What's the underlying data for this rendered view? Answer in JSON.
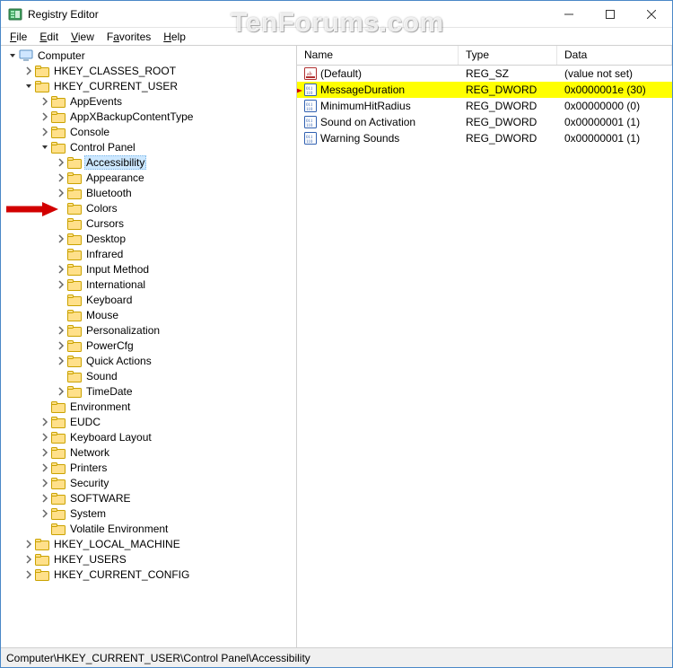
{
  "window": {
    "title": "Registry Editor"
  },
  "menu": {
    "file": "File",
    "edit": "Edit",
    "view": "View",
    "favorites": "Favorites",
    "help": "Help"
  },
  "watermark": "TenForums.com",
  "columns": {
    "name": "Name",
    "type": "Type",
    "data": "Data"
  },
  "values": [
    {
      "name": "(Default)",
      "type": "REG_SZ",
      "data": "(value not set)",
      "iconKind": "sz",
      "highlight": false
    },
    {
      "name": "MessageDuration",
      "type": "REG_DWORD",
      "data": "0x0000001e (30)",
      "iconKind": "dword",
      "highlight": true
    },
    {
      "name": "MinimumHitRadius",
      "type": "REG_DWORD",
      "data": "0x00000000 (0)",
      "iconKind": "dword",
      "highlight": false
    },
    {
      "name": "Sound on Activation",
      "type": "REG_DWORD",
      "data": "0x00000001 (1)",
      "iconKind": "dword",
      "highlight": false
    },
    {
      "name": "Warning Sounds",
      "type": "REG_DWORD",
      "data": "0x00000001 (1)",
      "iconKind": "dword",
      "highlight": false
    }
  ],
  "tree": [
    {
      "depth": 0,
      "exp": "open",
      "icon": "computer",
      "label": "Computer",
      "selected": false
    },
    {
      "depth": 1,
      "exp": "closed",
      "icon": "folder",
      "label": "HKEY_CLASSES_ROOT"
    },
    {
      "depth": 1,
      "exp": "open",
      "icon": "folder",
      "label": "HKEY_CURRENT_USER"
    },
    {
      "depth": 2,
      "exp": "closed",
      "icon": "folder",
      "label": "AppEvents"
    },
    {
      "depth": 2,
      "exp": "closed",
      "icon": "folder",
      "label": "AppXBackupContentType"
    },
    {
      "depth": 2,
      "exp": "closed",
      "icon": "folder",
      "label": "Console"
    },
    {
      "depth": 2,
      "exp": "open",
      "icon": "folder",
      "label": "Control Panel"
    },
    {
      "depth": 3,
      "exp": "closed",
      "icon": "folder",
      "label": "Accessibility",
      "selected": true
    },
    {
      "depth": 3,
      "exp": "closed",
      "icon": "folder",
      "label": "Appearance"
    },
    {
      "depth": 3,
      "exp": "closed",
      "icon": "folder",
      "label": "Bluetooth"
    },
    {
      "depth": 3,
      "exp": "none",
      "icon": "folder",
      "label": "Colors"
    },
    {
      "depth": 3,
      "exp": "none",
      "icon": "folder",
      "label": "Cursors"
    },
    {
      "depth": 3,
      "exp": "closed",
      "icon": "folder",
      "label": "Desktop"
    },
    {
      "depth": 3,
      "exp": "none",
      "icon": "folder",
      "label": "Infrared"
    },
    {
      "depth": 3,
      "exp": "closed",
      "icon": "folder",
      "label": "Input Method"
    },
    {
      "depth": 3,
      "exp": "closed",
      "icon": "folder",
      "label": "International"
    },
    {
      "depth": 3,
      "exp": "none",
      "icon": "folder",
      "label": "Keyboard"
    },
    {
      "depth": 3,
      "exp": "none",
      "icon": "folder",
      "label": "Mouse"
    },
    {
      "depth": 3,
      "exp": "closed",
      "icon": "folder",
      "label": "Personalization"
    },
    {
      "depth": 3,
      "exp": "closed",
      "icon": "folder",
      "label": "PowerCfg"
    },
    {
      "depth": 3,
      "exp": "closed",
      "icon": "folder",
      "label": "Quick Actions"
    },
    {
      "depth": 3,
      "exp": "none",
      "icon": "folder",
      "label": "Sound"
    },
    {
      "depth": 3,
      "exp": "closed",
      "icon": "folder",
      "label": "TimeDate"
    },
    {
      "depth": 2,
      "exp": "none",
      "icon": "folder",
      "label": "Environment"
    },
    {
      "depth": 2,
      "exp": "closed",
      "icon": "folder",
      "label": "EUDC"
    },
    {
      "depth": 2,
      "exp": "closed",
      "icon": "folder",
      "label": "Keyboard Layout"
    },
    {
      "depth": 2,
      "exp": "closed",
      "icon": "folder",
      "label": "Network"
    },
    {
      "depth": 2,
      "exp": "closed",
      "icon": "folder",
      "label": "Printers"
    },
    {
      "depth": 2,
      "exp": "closed",
      "icon": "folder",
      "label": "Security"
    },
    {
      "depth": 2,
      "exp": "closed",
      "icon": "folder",
      "label": "SOFTWARE"
    },
    {
      "depth": 2,
      "exp": "closed",
      "icon": "folder",
      "label": "System"
    },
    {
      "depth": 2,
      "exp": "none",
      "icon": "folder",
      "label": "Volatile Environment"
    },
    {
      "depth": 1,
      "exp": "closed",
      "icon": "folder",
      "label": "HKEY_LOCAL_MACHINE"
    },
    {
      "depth": 1,
      "exp": "closed",
      "icon": "folder",
      "label": "HKEY_USERS"
    },
    {
      "depth": 1,
      "exp": "closed",
      "icon": "folder",
      "label": "HKEY_CURRENT_CONFIG"
    }
  ],
  "statusbar": "Computer\\HKEY_CURRENT_USER\\Control Panel\\Accessibility"
}
